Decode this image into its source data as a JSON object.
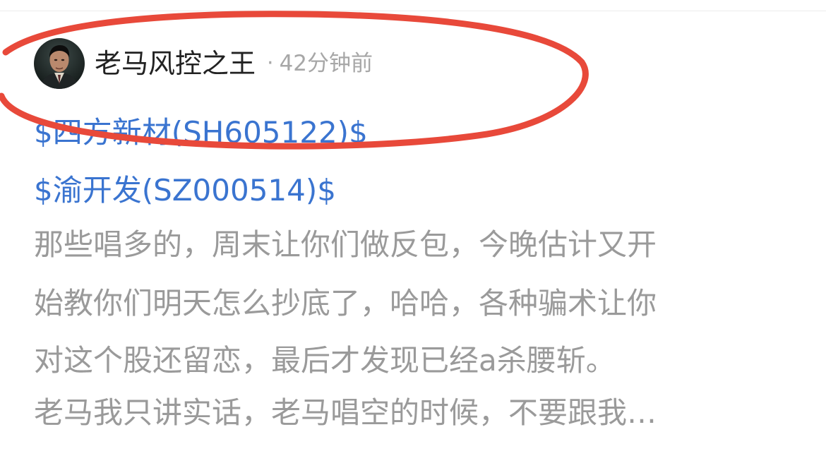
{
  "post": {
    "author_name": "老马风控之王",
    "meta_separator": "·",
    "time_ago": "42分钟前",
    "stock_tags": [
      "$四方新材(SH605122)$",
      "$渝开发(SZ000514)$"
    ],
    "body_lines": [
      "那些唱多的，周末让你们做反包，今晚估计又开",
      "始教你们明天怎么抄底了，哈哈，各种骗术让你",
      "对这个股还留恋，最后才发现已经a杀腰斩。",
      "老马我只讲实话，老马唱空的时候，不要跟我…"
    ]
  },
  "colors": {
    "author_text": "#222222",
    "meta_text": "#a7a7a7",
    "stock_link": "#3a74d0",
    "body_text": "#9a9a9a",
    "highlight_ellipse": "#e8493a"
  },
  "annotation": {
    "shape": "ellipse",
    "target": "author-header"
  }
}
